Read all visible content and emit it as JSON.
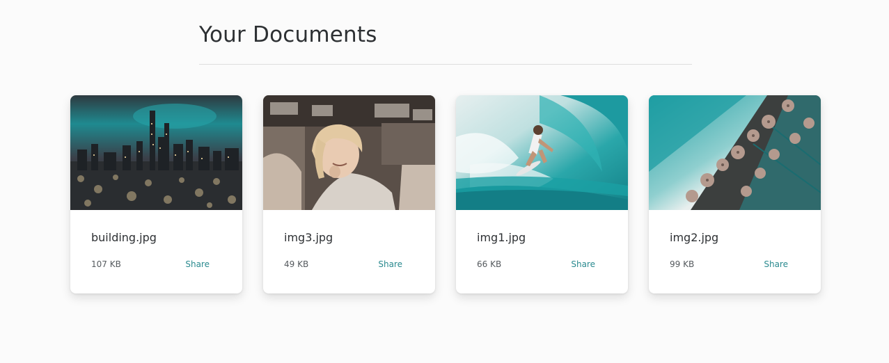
{
  "header": {
    "title": "Your Documents"
  },
  "documents": [
    {
      "name": "building.jpg",
      "size": "107 KB",
      "share_label": "Share",
      "thumbnail": "city-night-skyline"
    },
    {
      "name": "img3.jpg",
      "size": "49 KB",
      "share_label": "Share",
      "thumbnail": "smiling-woman"
    },
    {
      "name": "img1.jpg",
      "size": "66 KB",
      "share_label": "Share",
      "thumbnail": "surfer-wave"
    },
    {
      "name": "img2.jpg",
      "size": "99 KB",
      "share_label": "Share",
      "thumbnail": "beach-umbrellas-aerial"
    }
  ],
  "colors": {
    "accent": "#2a8a8f",
    "title": "#2d3033",
    "teal": "#1a9ba0"
  }
}
